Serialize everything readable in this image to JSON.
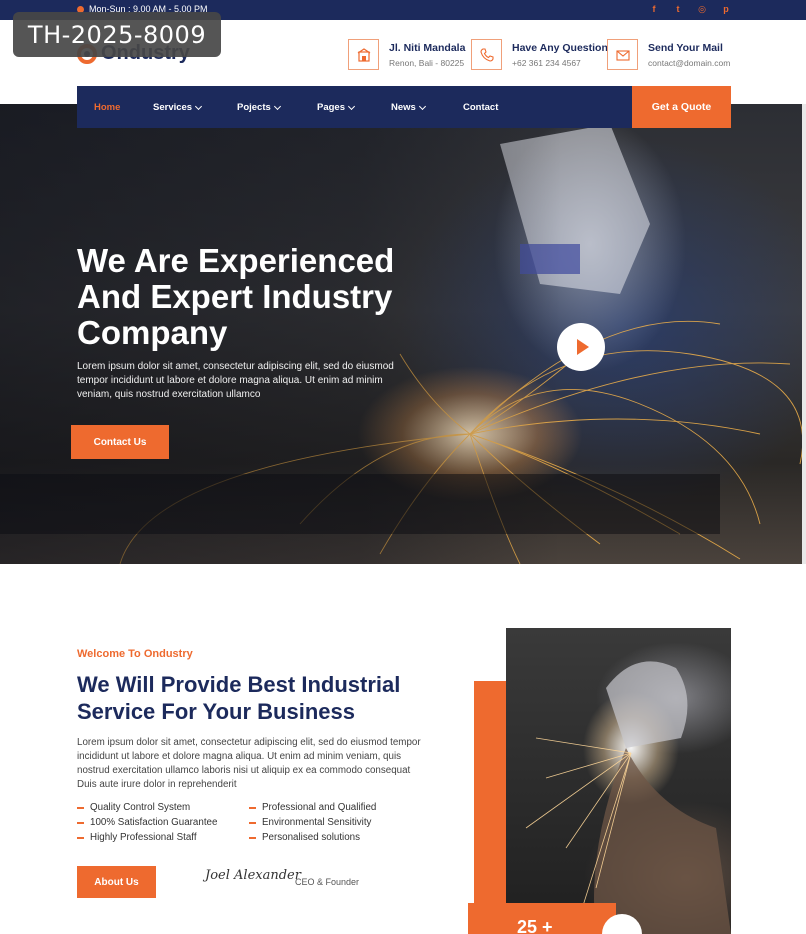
{
  "badge": "TH-2025-8009",
  "topbar": {
    "hours": "Mon-Sun : 9.00 AM - 5.00 PM",
    "socials": [
      {
        "icon": "facebook-icon",
        "glyph": "f"
      },
      {
        "icon": "twitter-icon",
        "glyph": "t"
      },
      {
        "icon": "instagram-icon",
        "glyph": "◎"
      },
      {
        "icon": "pinterest-icon",
        "glyph": "p"
      }
    ]
  },
  "header": {
    "logo": "Ondustry",
    "info": [
      {
        "icon": "building-icon",
        "title": "Jl. Niti Mandala",
        "sub": "Renon, Bali - 80225"
      },
      {
        "icon": "phone-icon",
        "title": "Have Any Question",
        "sub": "+62 361 234 4567"
      },
      {
        "icon": "mail-icon",
        "title": "Send Your Mail",
        "sub": "contact@domain.com"
      }
    ]
  },
  "nav": {
    "items": [
      {
        "label": "Home",
        "active": true,
        "dropdown": false
      },
      {
        "label": "Services",
        "active": false,
        "dropdown": true
      },
      {
        "label": "Pojects",
        "active": false,
        "dropdown": true
      },
      {
        "label": "Pages",
        "active": false,
        "dropdown": true
      },
      {
        "label": "News",
        "active": false,
        "dropdown": true
      },
      {
        "label": "Contact",
        "active": false,
        "dropdown": false
      }
    ],
    "cta": "Get a Quote"
  },
  "hero": {
    "title": "We Are Experienced And Expert Industry Company",
    "text": "Lorem ipsum dolor sit amet, consectetur adipiscing elit, sed do eiusmod tempor incididunt ut labore et dolore magna aliqua. Ut enim ad minim veniam, quis nostrud exercitation ullamco",
    "button": "Contact Us"
  },
  "about": {
    "kicker": "Welcome To Ondustry",
    "title": "We Will Provide Best Industrial Service For Your Business",
    "text": "Lorem ipsum dolor sit amet, consectetur adipiscing elit, sed do eiusmod tempor incididunt ut labore et dolore magna aliqua. Ut enim ad minim veniam, quis nostrud exercitation ullamco laboris nisi ut aliquip ex ea commodo consequat Duis aute irure dolor in reprehenderit",
    "features": [
      "Quality Control System",
      "Professional and Qualified",
      "100% Satisfaction Guarantee",
      "Environmental Sensitivity",
      "Highly Professional Staff",
      "Personalised solutions"
    ],
    "button": "About Us",
    "signature": "Joel Alexander",
    "role": "CEO & Founder",
    "stat": "25 +"
  },
  "colors": {
    "primary": "#1c2a5c",
    "accent": "#ee6a2f"
  }
}
